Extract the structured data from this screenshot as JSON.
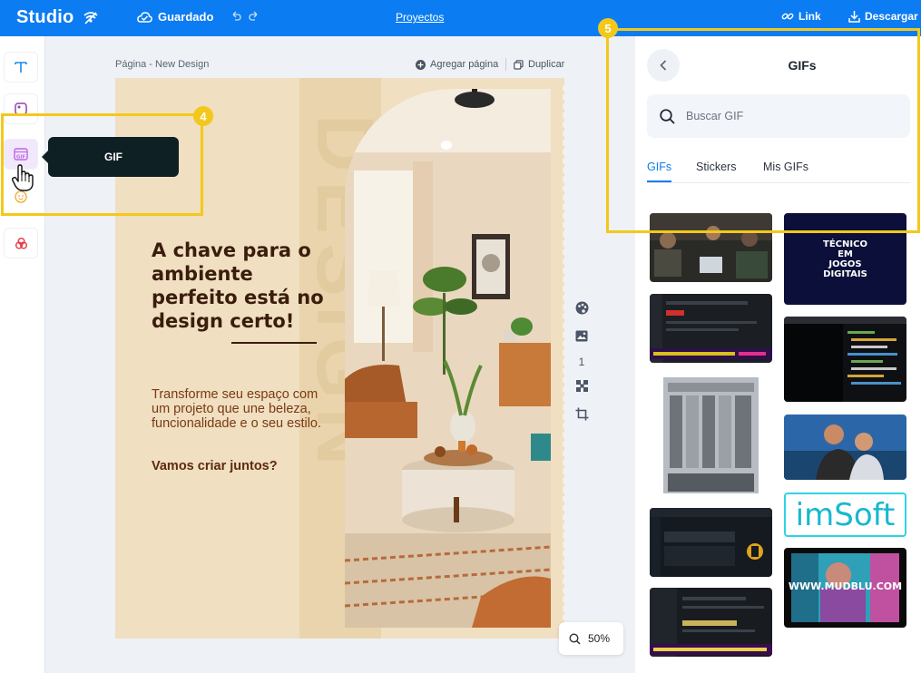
{
  "topbar": {
    "logo": "Studio",
    "saved_label": "Guardado",
    "projects_label": "Proyectos",
    "link_label": "Link",
    "download_label": "Descargar"
  },
  "rail": {
    "items": [
      "text-icon",
      "elements-icon",
      "gif-icon",
      "emoji-icon",
      "brand-icon"
    ],
    "tooltip": "GIF"
  },
  "canvas": {
    "page_title": "Página - New Design",
    "add_page_label": "Agregar página",
    "duplicate_label": "Duplicar",
    "page_number": "1",
    "zoom": "50%"
  },
  "design": {
    "headline": "A chave para o ambiente perfeito está no design certo!",
    "subtext": "Transforme seu espaço com um projeto que une beleza, funcionalidade e o seu estilo.",
    "cta": "Vamos criar juntos?",
    "background_word": "DESIGN",
    "colors": {
      "background": "#f0dfc1",
      "headline": "#3a1d0c",
      "subtext": "#7a3a12"
    }
  },
  "panel": {
    "title": "GIFs",
    "search_placeholder": "Buscar GIF",
    "tabs": [
      "GIFs",
      "Stickers",
      "Mis GIFs"
    ],
    "active_tab": "GIFs",
    "gif_texts": {
      "gif2": "TÉCNICO EM JOGOS DIGITAIS",
      "gif7": "imSoft",
      "gif9": "WWW.MUDBLU.COM"
    }
  },
  "tutorial": {
    "step4": "4",
    "step5": "5",
    "highlight_color": "#f3c81b"
  },
  "theme": {
    "accent": "#0c7cf2"
  }
}
